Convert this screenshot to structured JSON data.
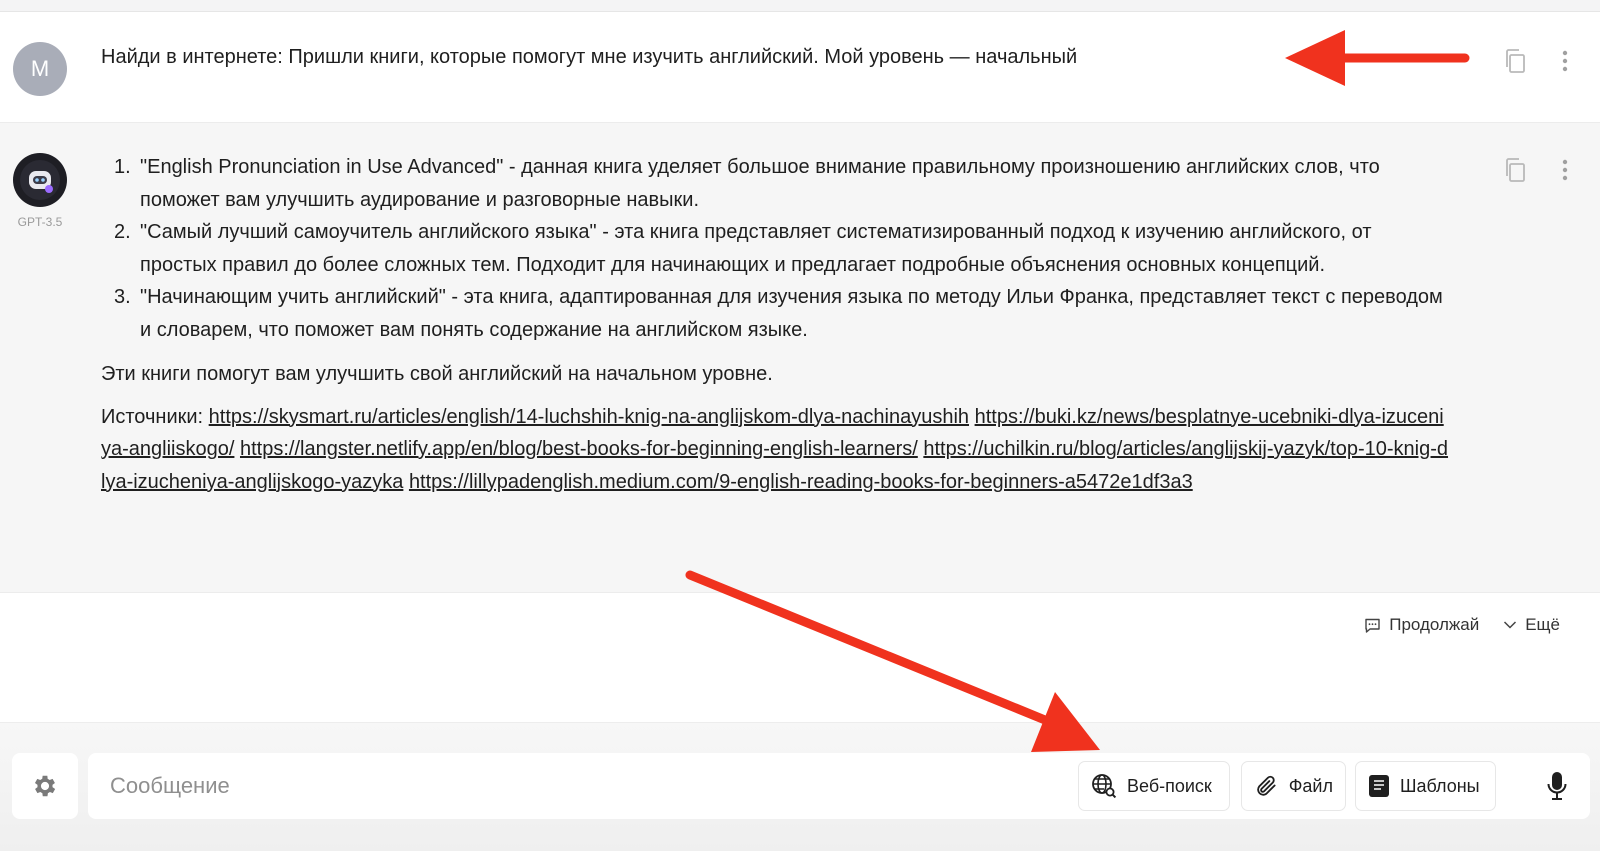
{
  "user_message": {
    "avatar_letter": "M",
    "text": "Найди в интернете: Пришли книги, которые помогут мне изучить английский. Мой уровень — начальный"
  },
  "bot_message": {
    "model": "GPT-3.5",
    "list": [
      {
        "num": "1.",
        "text": "\"English Pronunciation in Use Advanced\" - данная книга уделяет большое внимание правильному произношению английских слов, что поможет вам улучшить аудирование и разговорные навыки."
      },
      {
        "num": "2.",
        "text": "\"Самый лучший самоучитель английского языка\" - эта книга представляет систематизированный подход к изучению английского, от простых правил до более сложных тем. Подходит для начинающих и предлагает подробные объяснения основных концепций."
      },
      {
        "num": "3.",
        "text": "\"Начинающим учить английский\" - эта книга, адаптированная для изучения языка по методу Ильи Франка, представляет текст с переводом и словарем, что поможет вам понять содержание на английском языке."
      }
    ],
    "summary": "Эти книги помогут вам улучшить свой английский на начальном уровне.",
    "sources_label": "Источники:",
    "sources": [
      "https://skysmart.ru/articles/english/14-luchshih-knig-na-anglijskom-dlya-nachinayushih",
      "https://buki.kz/news/besplatnye-ucebniki-dlya-izuceniya-angliiskogo/",
      "https://langster.netlify.app/en/blog/best-books-for-beginning-english-learners/",
      "https://uchilkin.ru/blog/articles/anglijskij-yazyk/top-10-knig-dlya-izucheniya-anglijskogo-yazyka",
      "https://lillypadenglish.medium.com/9-english-reading-books-for-beginners-a5472e1df3a3"
    ]
  },
  "actions": {
    "continue_label": "Продолжай",
    "more_label": "Ещё"
  },
  "composer": {
    "placeholder": "Сообщение",
    "web_search_label": "Веб-поиск",
    "file_label": "Файл",
    "templates_label": "Шаблоны"
  },
  "colors": {
    "annotation_arrow": "#f0321e",
    "bot_background": "#f6f6f6",
    "user_avatar": "#a9adb8"
  }
}
